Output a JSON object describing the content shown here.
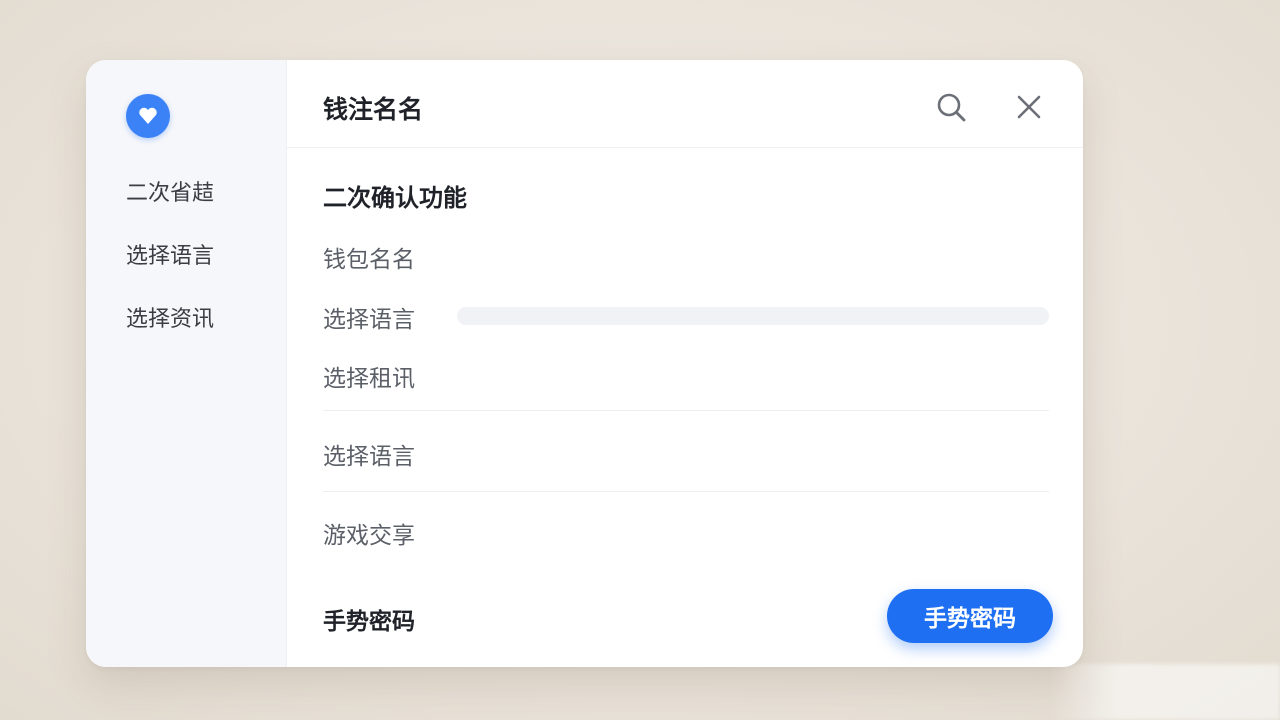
{
  "sidebar": {
    "logo_icon": "shield-heart-icon",
    "accent_color": "#3b82f6",
    "items": [
      {
        "label": "二次省趌"
      },
      {
        "label": "选择语言"
      },
      {
        "label": "选择资讯"
      }
    ]
  },
  "header": {
    "title": "钱注名名",
    "search_icon": "search-icon",
    "close_icon": "close-icon"
  },
  "main": {
    "section_title": "二次确认功能",
    "rows": [
      {
        "label": "钱包名名"
      },
      {
        "label": "选择语言"
      },
      {
        "label": "选择租讯"
      },
      {
        "label": "选择语言"
      },
      {
        "label": "游戏交享"
      }
    ],
    "footer_title": "手势密码",
    "primary_button": "手势密码",
    "button_color": "#1f6ff2"
  }
}
